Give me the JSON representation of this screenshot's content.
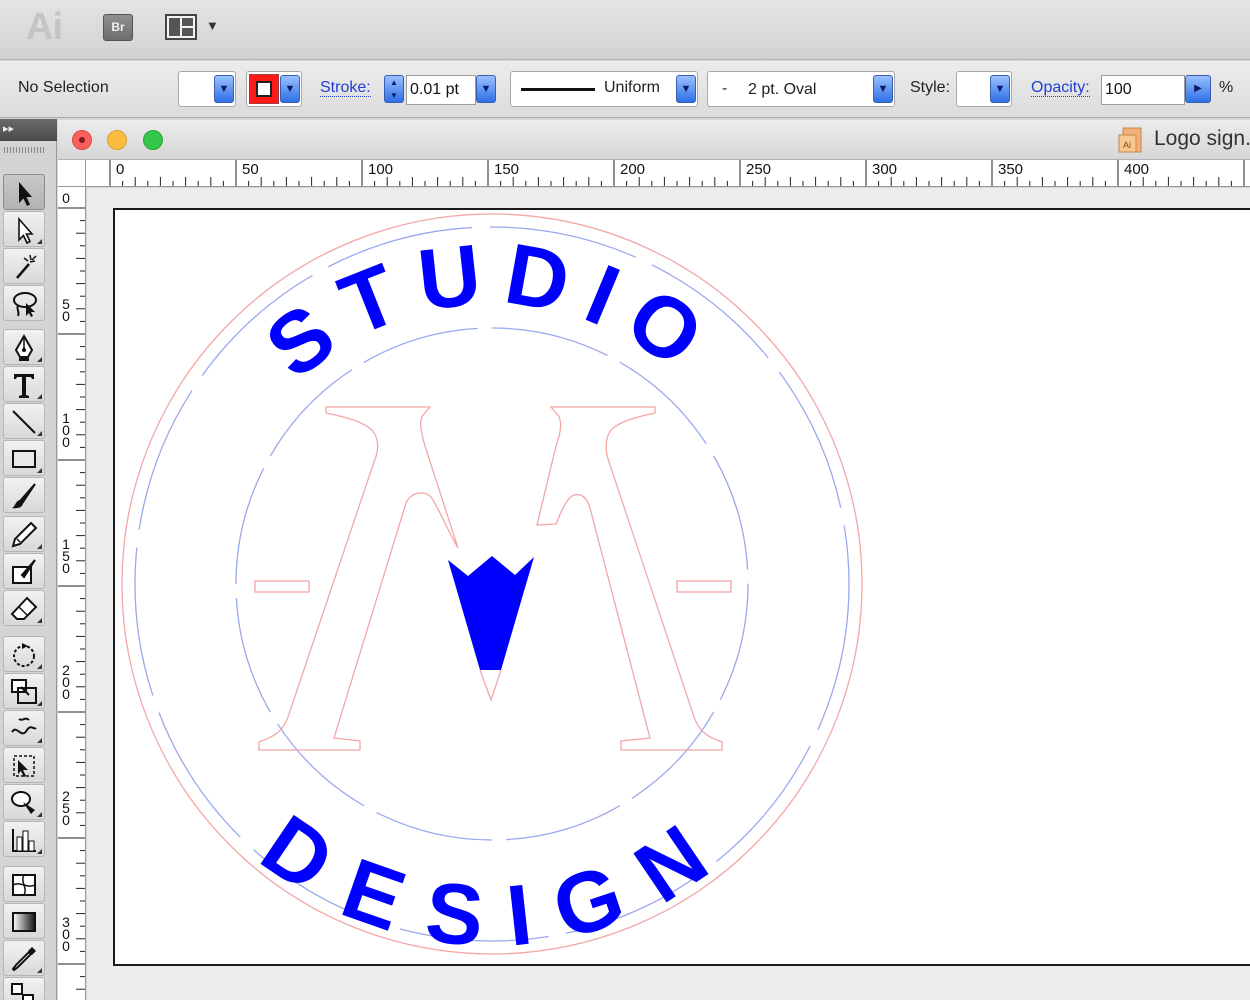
{
  "app": {
    "logo_text": "Ai",
    "bridge_label": "Br"
  },
  "control_bar": {
    "selection_status": "No Selection",
    "stroke_label": "Stroke:",
    "stroke_weight": "0.01 pt",
    "variable_width_profile": "Uniform",
    "brush_definition_dash": "-",
    "brush_definition": "2 pt. Oval",
    "style_label": "Style:",
    "opacity_label": "Opacity:",
    "opacity_value": "100",
    "opacity_unit": "%",
    "stroke_color": "#ff0000"
  },
  "document": {
    "title": "Logo sign.ai*",
    "title_overflow": "@"
  },
  "rulers": {
    "horizontal": [
      "0",
      "50",
      "100",
      "150",
      "200",
      "250",
      "300",
      "350",
      "400"
    ],
    "vertical": [
      "0",
      "50",
      "100",
      "150",
      "200",
      "250",
      "300"
    ]
  },
  "artwork": {
    "top_text": "STUDIO",
    "bottom_text": "DESIGN",
    "text_color": "#0000ff",
    "guide_red": "#f4a6a6",
    "guide_blue": "#9aa8ee"
  },
  "tools": [
    "selection-tool",
    "direct-selection-tool",
    "magic-wand-tool",
    "lasso-tool",
    "pen-tool",
    "type-tool",
    "line-segment-tool",
    "rectangle-tool",
    "paintbrush-tool",
    "pencil-tool",
    "blob-brush-tool",
    "eraser-tool",
    "rotate-tool",
    "scale-tool",
    "warp-tool",
    "free-transform-tool",
    "symbol-sprayer-tool",
    "column-graph-tool",
    "mesh-tool",
    "gradient-tool",
    "eyedropper-tool",
    "blend-tool"
  ]
}
